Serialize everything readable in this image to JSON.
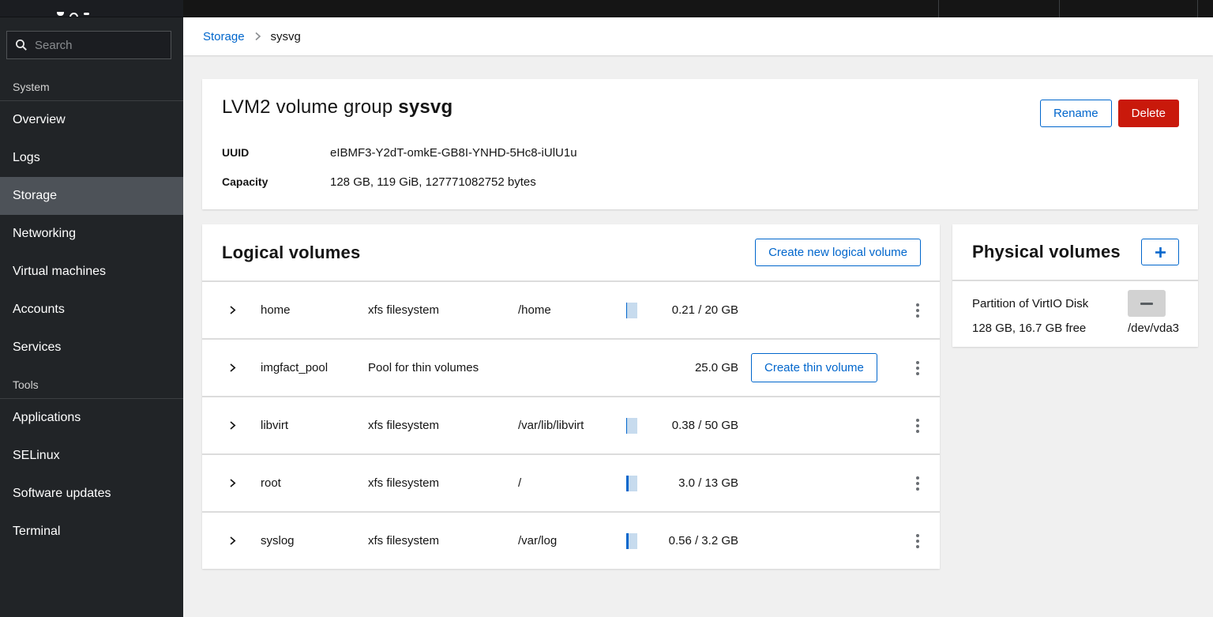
{
  "colors": {
    "accent": "#0066cc",
    "danger": "#c9190b",
    "sidebar_bg": "#212427",
    "active_item_bg": "#4d5258",
    "bar_fill": "#0066cc",
    "bar_bg": "#c7dbee"
  },
  "sidebar": {
    "search": {
      "placeholder": "Search"
    },
    "sections": [
      {
        "label": "System",
        "items": [
          {
            "label": "Overview"
          },
          {
            "label": "Logs"
          },
          {
            "label": "Storage"
          },
          {
            "label": "Networking"
          },
          {
            "label": "Virtual machines"
          },
          {
            "label": "Accounts"
          },
          {
            "label": "Services"
          }
        ]
      },
      {
        "label": "Tools",
        "items": [
          {
            "label": "Applications"
          },
          {
            "label": "SELinux"
          },
          {
            "label": "Software updates"
          },
          {
            "label": "Terminal"
          }
        ]
      }
    ],
    "active_item": "Storage"
  },
  "breadcrumb": {
    "link": "Storage",
    "current": "sysvg"
  },
  "vg_card": {
    "title_prefix": "LVM2 volume group ",
    "title_name": "sysvg",
    "rename_label": "Rename",
    "delete_label": "Delete",
    "fields": [
      {
        "label": "UUID",
        "value": "eIBMF3-Y2dT-omkE-GB8I-YNHD-5Hc8-iUlU1u"
      },
      {
        "label": "Capacity",
        "value": "128 GB, 119 GiB, 127771082752 bytes"
      }
    ]
  },
  "logical_volumes": {
    "title": "Logical volumes",
    "create_button": "Create new logical volume",
    "rows": [
      {
        "name": "home",
        "type": "xfs filesystem",
        "mount": "/home",
        "usage": "0.21 / 20 GB",
        "usage_pct": 1
      },
      {
        "name": "imgfact_pool",
        "type": "Pool for thin volumes",
        "mount": "",
        "usage": "25.0 GB",
        "button": "Create thin volume"
      },
      {
        "name": "libvirt",
        "type": "xfs filesystem",
        "mount": "/var/lib/libvirt",
        "usage": "0.38 / 50 GB",
        "usage_pct": 1
      },
      {
        "name": "root",
        "type": "xfs filesystem",
        "mount": "/",
        "usage": "3.0 / 13 GB",
        "usage_pct": 23
      },
      {
        "name": "syslog",
        "type": "xfs filesystem",
        "mount": "/var/log",
        "usage": "0.56 / 3.2 GB",
        "usage_pct": 18
      }
    ]
  },
  "physical_volumes": {
    "title": "Physical volumes",
    "rows": [
      {
        "name": "Partition of VirtIO Disk",
        "size": "128 GB, 16.7 GB free",
        "device": "/dev/vda3"
      }
    ]
  }
}
